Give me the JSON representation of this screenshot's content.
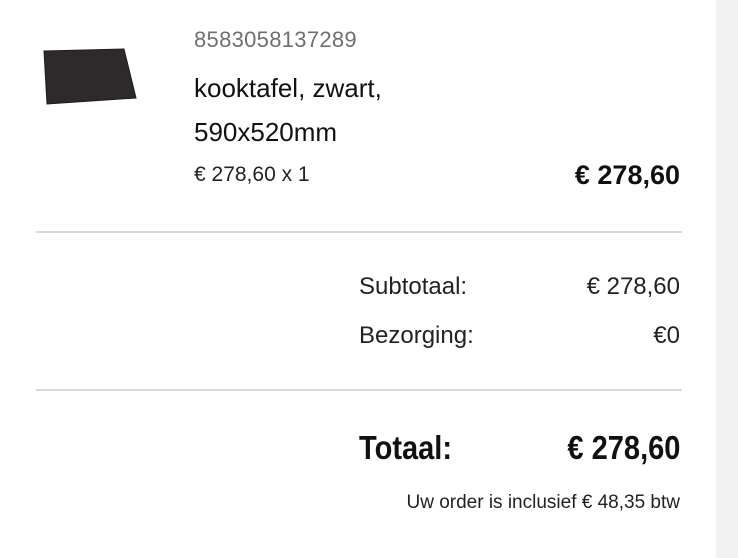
{
  "product": {
    "image_icon": "cooktop-product-image",
    "sku": "8583058137289",
    "name": "kooktafel, zwart, 590x520mm",
    "unit_price_line": "€ 278,60 x 1",
    "line_total": "€ 278,60"
  },
  "summary": {
    "subtotal_label": "Subtotaal:",
    "subtotal_value": "€ 278,60",
    "shipping_label": "Bezorging:",
    "shipping_value": "€0"
  },
  "total": {
    "label": "Totaal:",
    "value": "€ 278,60",
    "vat_note": "Uw order is inclusief € 48,35 btw"
  }
}
